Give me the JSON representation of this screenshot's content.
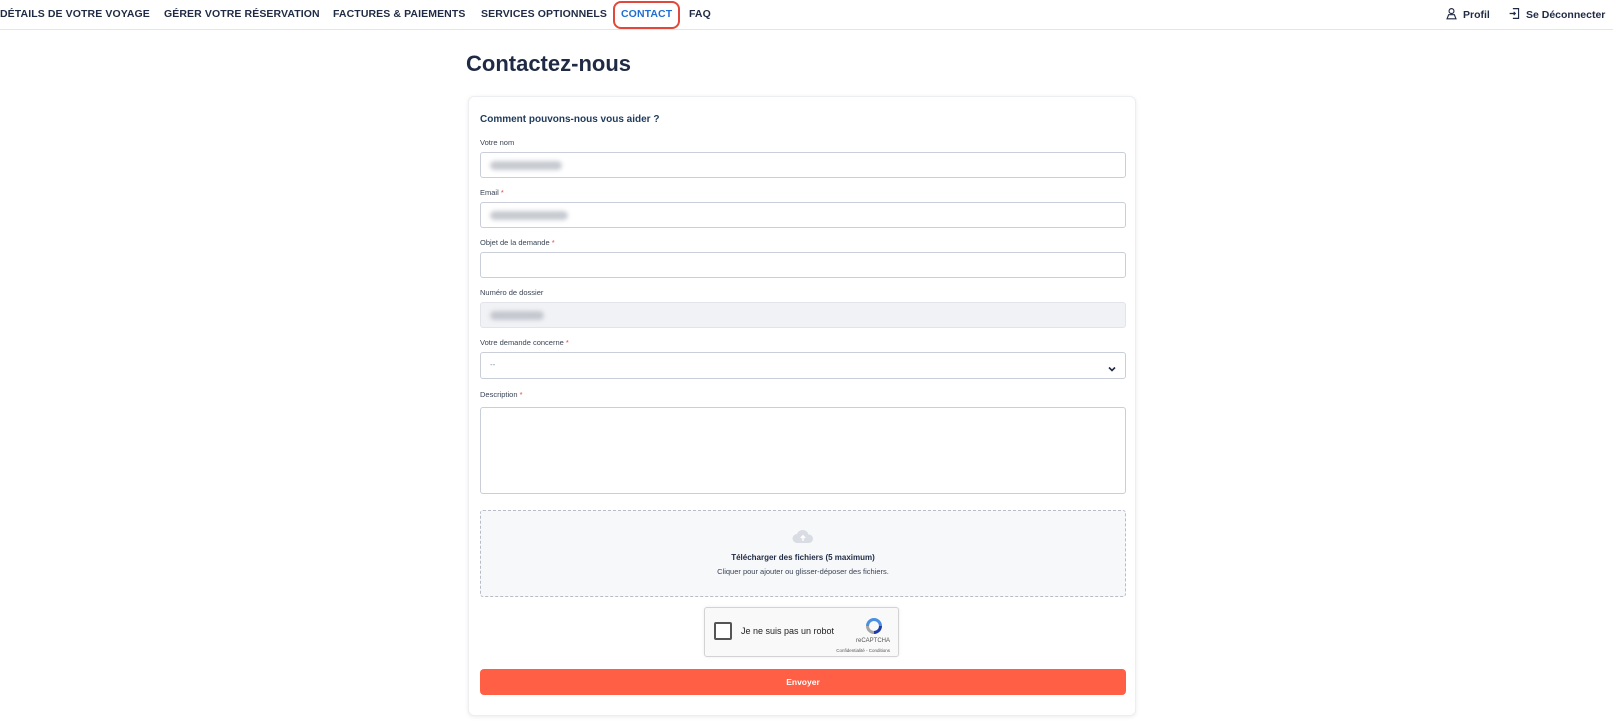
{
  "nav": {
    "items": [
      {
        "label": "DÉTAILS DE VOTRE VOYAGE"
      },
      {
        "label": "GÉRER VOTRE RÉSERVATION"
      },
      {
        "label": "FACTURES & PAIEMENTS"
      },
      {
        "label": "SERVICES OPTIONNELS"
      },
      {
        "label": "CONTACT",
        "active": true
      },
      {
        "label": "FAQ"
      }
    ],
    "profile_label": "Profil",
    "logout_label": "Se Déconnecter",
    "profile_icon": "user-icon",
    "logout_icon": "logout-icon",
    "active_color": "#1f6fd1",
    "highlight_color": "#e2473c"
  },
  "page": {
    "title": "Contactez-nous"
  },
  "form": {
    "heading": "Comment pouvons-nous vous aider ?",
    "name_label": "Votre nom",
    "email_label": "Email",
    "subject_label": "Objet de la demande",
    "dossier_label": "Numéro de dossier",
    "concern_label": "Votre demande concerne",
    "concern_value": "--",
    "description_label": "Description",
    "required_mark": "*",
    "upload_title": "Télécharger des fichiers (5 maximum)",
    "upload_subtitle": "Cliquer pour ajouter ou glisser-déposer des fichiers.",
    "upload_icon": "cloud-upload-icon",
    "captcha_text": "Je ne suis pas un robot",
    "captcha_brand": "reCAPTCHA",
    "captcha_links": "Confidentialité - Conditions",
    "submit_label": "Envoyer",
    "submit_color": "#ff5f45"
  }
}
